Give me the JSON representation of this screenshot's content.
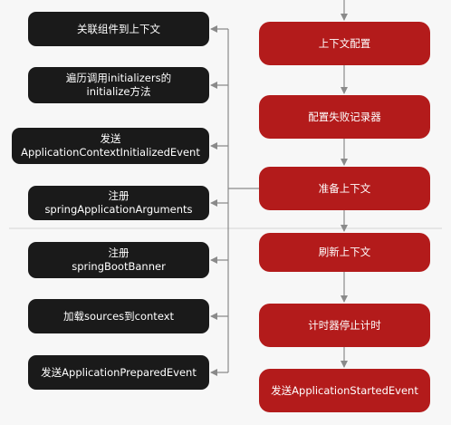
{
  "diagram": {
    "left_steps": [
      {
        "label": "关联组件到上下文"
      },
      {
        "label": "遍历调用initializers的\ninitialize方法"
      },
      {
        "label": "发送\nApplicationContextInitializedEvent"
      },
      {
        "label": "注册springApplicationArguments"
      },
      {
        "label": "注册\nspringBootBanner"
      },
      {
        "label": "加载sources到context"
      },
      {
        "label": "发送ApplicationPreparedEvent"
      }
    ],
    "right_steps": [
      {
        "label": "上下文配置"
      },
      {
        "label": "配置失败记录器"
      },
      {
        "label": "准备上下文"
      },
      {
        "label": "刷新上下文"
      },
      {
        "label": "计时器停止计时"
      },
      {
        "label": "发送ApplicationStartedEvent"
      }
    ],
    "colors": {
      "left_box": "#1a1a1a",
      "right_box": "#b31b1b",
      "connector": "#8a8a8a",
      "background": "#f7f7f7"
    }
  }
}
